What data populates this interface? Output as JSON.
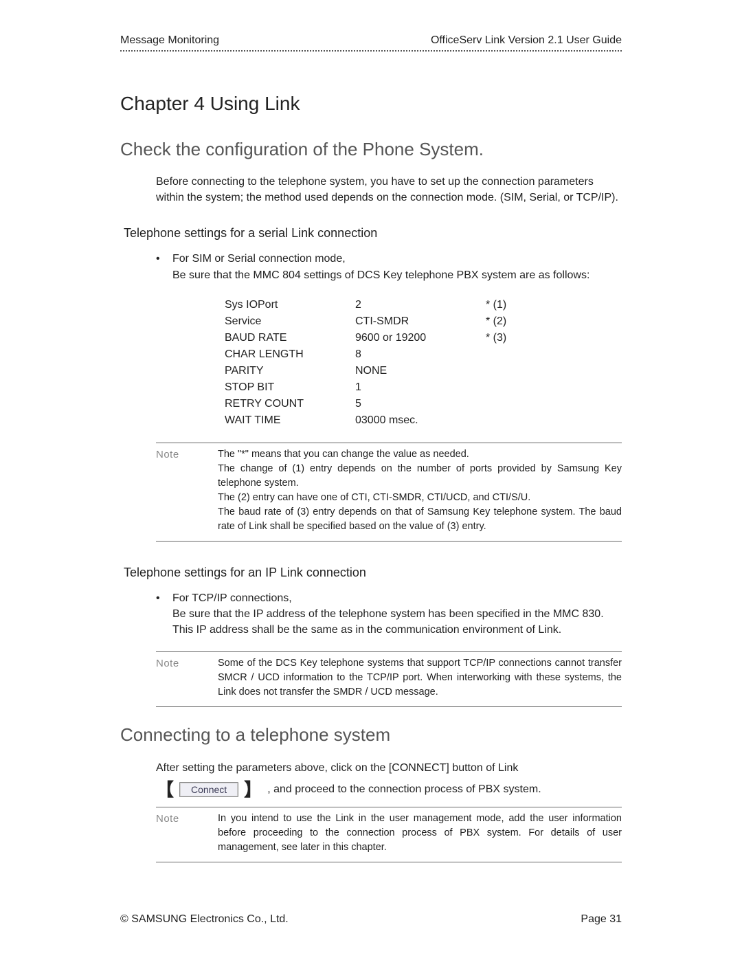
{
  "header": {
    "left": "Message Monitoring",
    "right": "OfficeServ Link Version 2.1 User Guide"
  },
  "chapter_title": "Chapter 4 Using Link",
  "section1": {
    "title": "Check the configuration of the Phone System.",
    "intro": "Before connecting to the telephone system, you have to set up the connection parameters within the system; the method used depends on the connection mode. (SIM, Serial, or TCP/IP).",
    "sub_serial": {
      "heading": "Telephone settings for a serial Link connection",
      "bullet_line1": "For SIM or Serial connection mode,",
      "bullet_line2": "Be sure that the MMC 804 settings of DCS Key telephone PBX system are as follows:",
      "settings": [
        {
          "name": "Sys IOPort",
          "value": "2",
          "mark": "* (1)"
        },
        {
          "name": "Service",
          "value": "CTI-SMDR",
          "mark": "* (2)"
        },
        {
          "name": "BAUD RATE",
          "value": "9600 or 19200",
          "mark": "* (3)"
        },
        {
          "name": "CHAR LENGTH",
          "value": "8",
          "mark": ""
        },
        {
          "name": "PARITY",
          "value": "NONE",
          "mark": ""
        },
        {
          "name": "STOP BIT",
          "value": "1",
          "mark": ""
        },
        {
          "name": "RETRY COUNT",
          "value": "5",
          "mark": ""
        },
        {
          "name": "WAIT TIME",
          "value": "03000 msec.",
          "mark": ""
        }
      ],
      "note_label": "Note",
      "note_text": "The \"*\" means that you can change the value as needed.\nThe change of (1) entry depends on the number of ports provided by Samsung Key telephone system.\nThe (2) entry can have one of CTI, CTI-SMDR, CTI/UCD, and CTI/S/U.\nThe baud rate of (3) entry depends on that of Samsung Key telephone system. The baud rate of Link shall be specified based on the value of (3) entry."
    },
    "sub_ip": {
      "heading": "Telephone settings for an IP Link connection",
      "bullet_line1": "For TCP/IP connections,",
      "bullet_line2": "Be sure that the IP address of the telephone system has been specified in the MMC 830.   This IP address shall be the same as in the communication environment of Link.",
      "note_label": "Note",
      "note_text": "Some of the DCS Key telephone systems that support TCP/IP connections cannot transfer SMCR / UCD information to the TCP/IP port. When interworking with these systems, the Link does not transfer the SMDR / UCD message."
    }
  },
  "section2": {
    "title": "Connecting to a telephone system",
    "line1": "After setting the parameters above, click on the [CONNECT] button of Link",
    "button_label": "Connect",
    "line2_tail": ", and proceed to the connection process of PBX system.",
    "note_label": "Note",
    "note_text": "In you intend to use the Link in the user management mode, add the user information before proceeding to the connection process of PBX system. For details of user management, see later in this chapter."
  },
  "footer": {
    "left": "© SAMSUNG Electronics Co., Ltd.",
    "right": "Page 31"
  }
}
